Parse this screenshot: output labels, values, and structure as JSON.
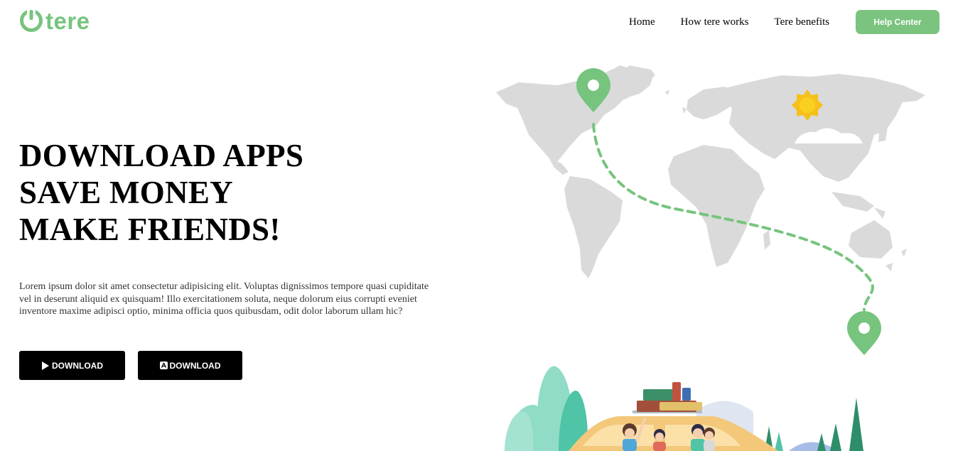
{
  "brand": {
    "name": "tere",
    "color": "#76c47e"
  },
  "nav": {
    "items": [
      "Home",
      "How tere works",
      "Tere benefits"
    ],
    "help_label": "Help Center"
  },
  "hero": {
    "headline": [
      "DOWNLOAD APPS",
      "SAVE MONEY",
      "MAKE FRIENDS!"
    ],
    "body": "Lorem ipsum dolor sit amet consectetur adipisicing elit. Voluptas dignissimos tempore quasi cupiditate vel in deserunt aliquid ex quisquam! Illo exercitationem soluta, neque dolorum eius corrupti eveniet inventore maxime adipisci optio, minima officia quos quibusdam, odit dolor laborum ullam hic?",
    "buttons": [
      {
        "label": "DOWNLOAD",
        "icon": "play-store-icon"
      },
      {
        "label": "DOWNLOAD",
        "icon": "app-store-icon"
      }
    ]
  },
  "illustration": {
    "icons": [
      "world-map",
      "location-pin-icon",
      "sun-icon",
      "cloud-icon",
      "car-with-travelers",
      "trees"
    ],
    "colors": {
      "map": "#dadada",
      "accent": "#76c47e",
      "sun": "#f6c01a"
    }
  }
}
